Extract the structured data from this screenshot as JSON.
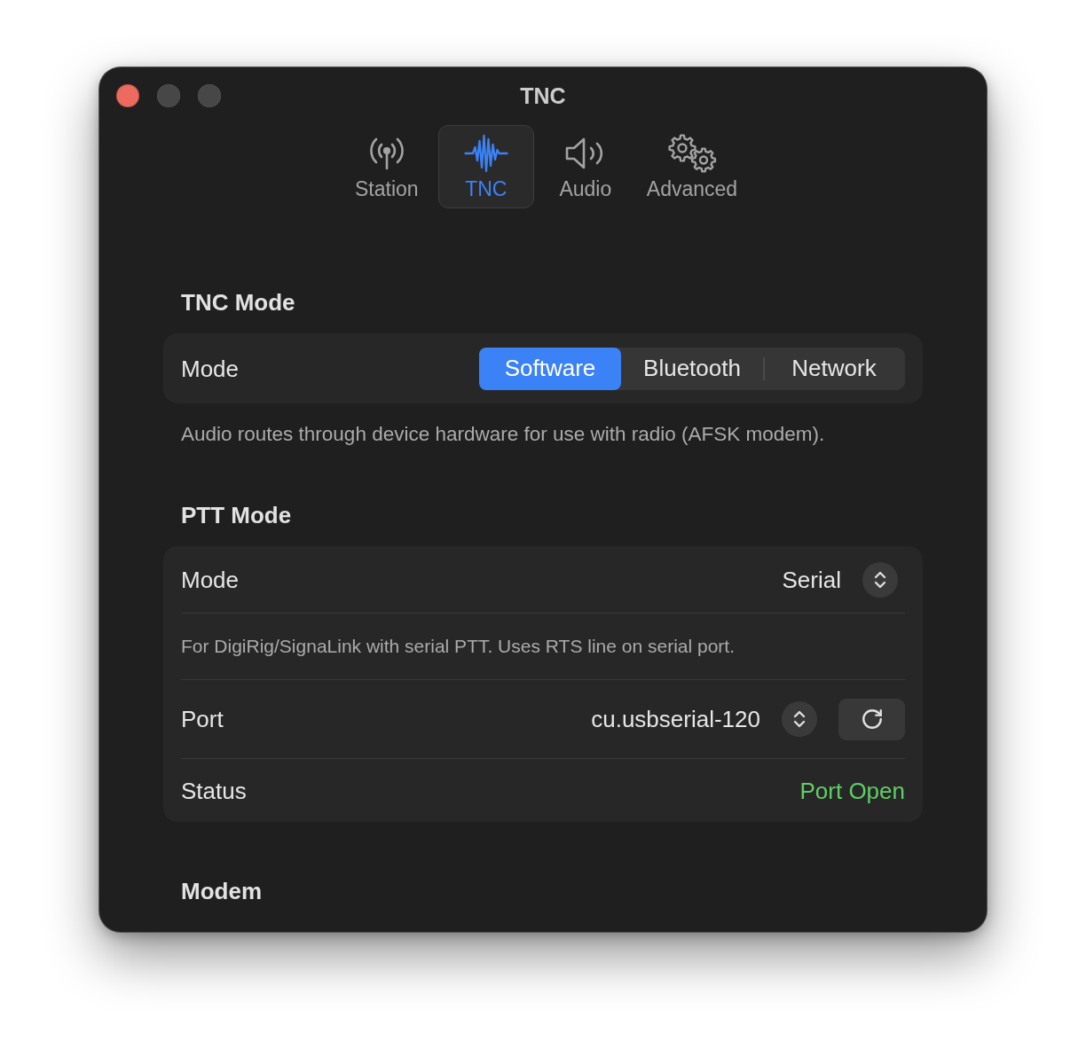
{
  "window": {
    "title": "TNC",
    "controls": [
      {
        "kind": "close",
        "disabled": false
      },
      {
        "kind": "minimize",
        "disabled": true
      },
      {
        "kind": "zoom",
        "disabled": true
      }
    ]
  },
  "toolbar": {
    "tabs": [
      {
        "kind": "antenna",
        "label": "Station",
        "selected": false
      },
      {
        "kind": "waveform",
        "label": "TNC",
        "selected": true
      },
      {
        "kind": "speaker",
        "label": "Audio",
        "selected": false
      },
      {
        "kind": "gears",
        "label": "Advanced",
        "selected": false
      }
    ]
  },
  "sections": [
    {
      "title": "TNC Mode",
      "rows": [
        {
          "kind": "segmented",
          "label": "Mode",
          "options": [
            {
              "label": "Software",
              "selected": true
            },
            {
              "label": "Bluetooth",
              "selected": false
            },
            {
              "label": "Network",
              "selected": false
            }
          ]
        }
      ],
      "footnote": "Audio routes through device hardware for use with radio (AFSK modem)."
    },
    {
      "title": "PTT Mode",
      "rows": [
        {
          "kind": "popup",
          "label": "Mode",
          "value": "Serial"
        },
        {
          "kind": "note",
          "text": "For DigiRig/SignaLink with serial PTT. Uses RTS line on serial port."
        },
        {
          "kind": "popup",
          "label": "Port",
          "value": "cu.usbserial-120",
          "refresh": true
        },
        {
          "kind": "status",
          "label": "Status",
          "value": "Port Open",
          "color": "#5fcf65"
        }
      ]
    },
    {
      "title": "Modem"
    }
  ]
}
